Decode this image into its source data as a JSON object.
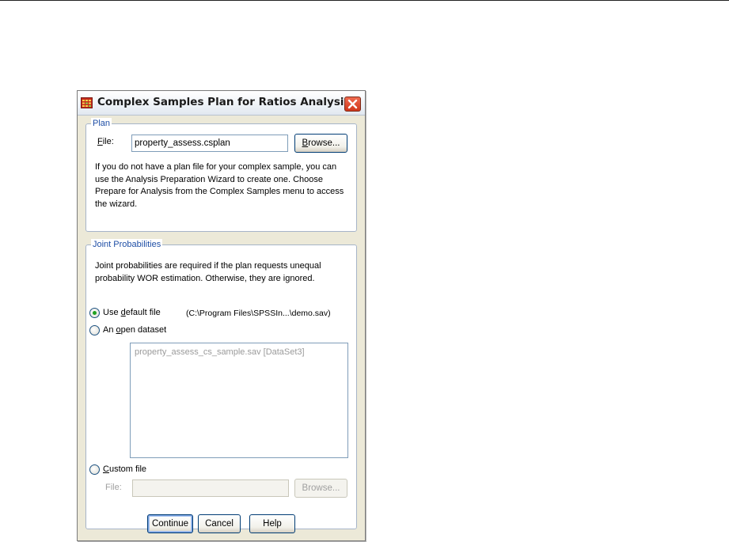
{
  "dialog": {
    "title": "Complex Samples Plan for Ratios Analysis",
    "icon": "data-grid-icon"
  },
  "plan": {
    "legend": "Plan",
    "file_label": "File:",
    "file_value": "property_assess.csplan",
    "browse_label": "Browse...",
    "info_text": "If you do not have a plan file for your complex sample, you can use the Analysis Preparation Wizard to create one. Choose Prepare for Analysis from the Complex Samples menu to access the wizard."
  },
  "joint": {
    "legend": "Joint Probabilities",
    "info_text": "Joint probabilities are required if the plan requests unequal probability WOR estimation. Otherwise, they are ignored.",
    "options": [
      {
        "label": "Use default file",
        "selected": true
      },
      {
        "label": "An open dataset",
        "selected": false
      },
      {
        "label": "Custom file",
        "selected": false
      }
    ],
    "default_path": "(C:\\Program Files\\SPSSIn...\\demo.sav)",
    "datasets": [
      "property_assess_cs_sample.sav [DataSet3]"
    ],
    "custom_file_label": "File:",
    "custom_file_value": "",
    "custom_browse_label": "Browse..."
  },
  "buttons": {
    "continue": "Continue",
    "cancel": "Cancel",
    "help": "Help"
  },
  "colors": {
    "dialog_bg": "#ece9d8",
    "legend_text": "#1f4fa6",
    "close_button": "#d0361a",
    "radio_selected": "#21a121"
  }
}
